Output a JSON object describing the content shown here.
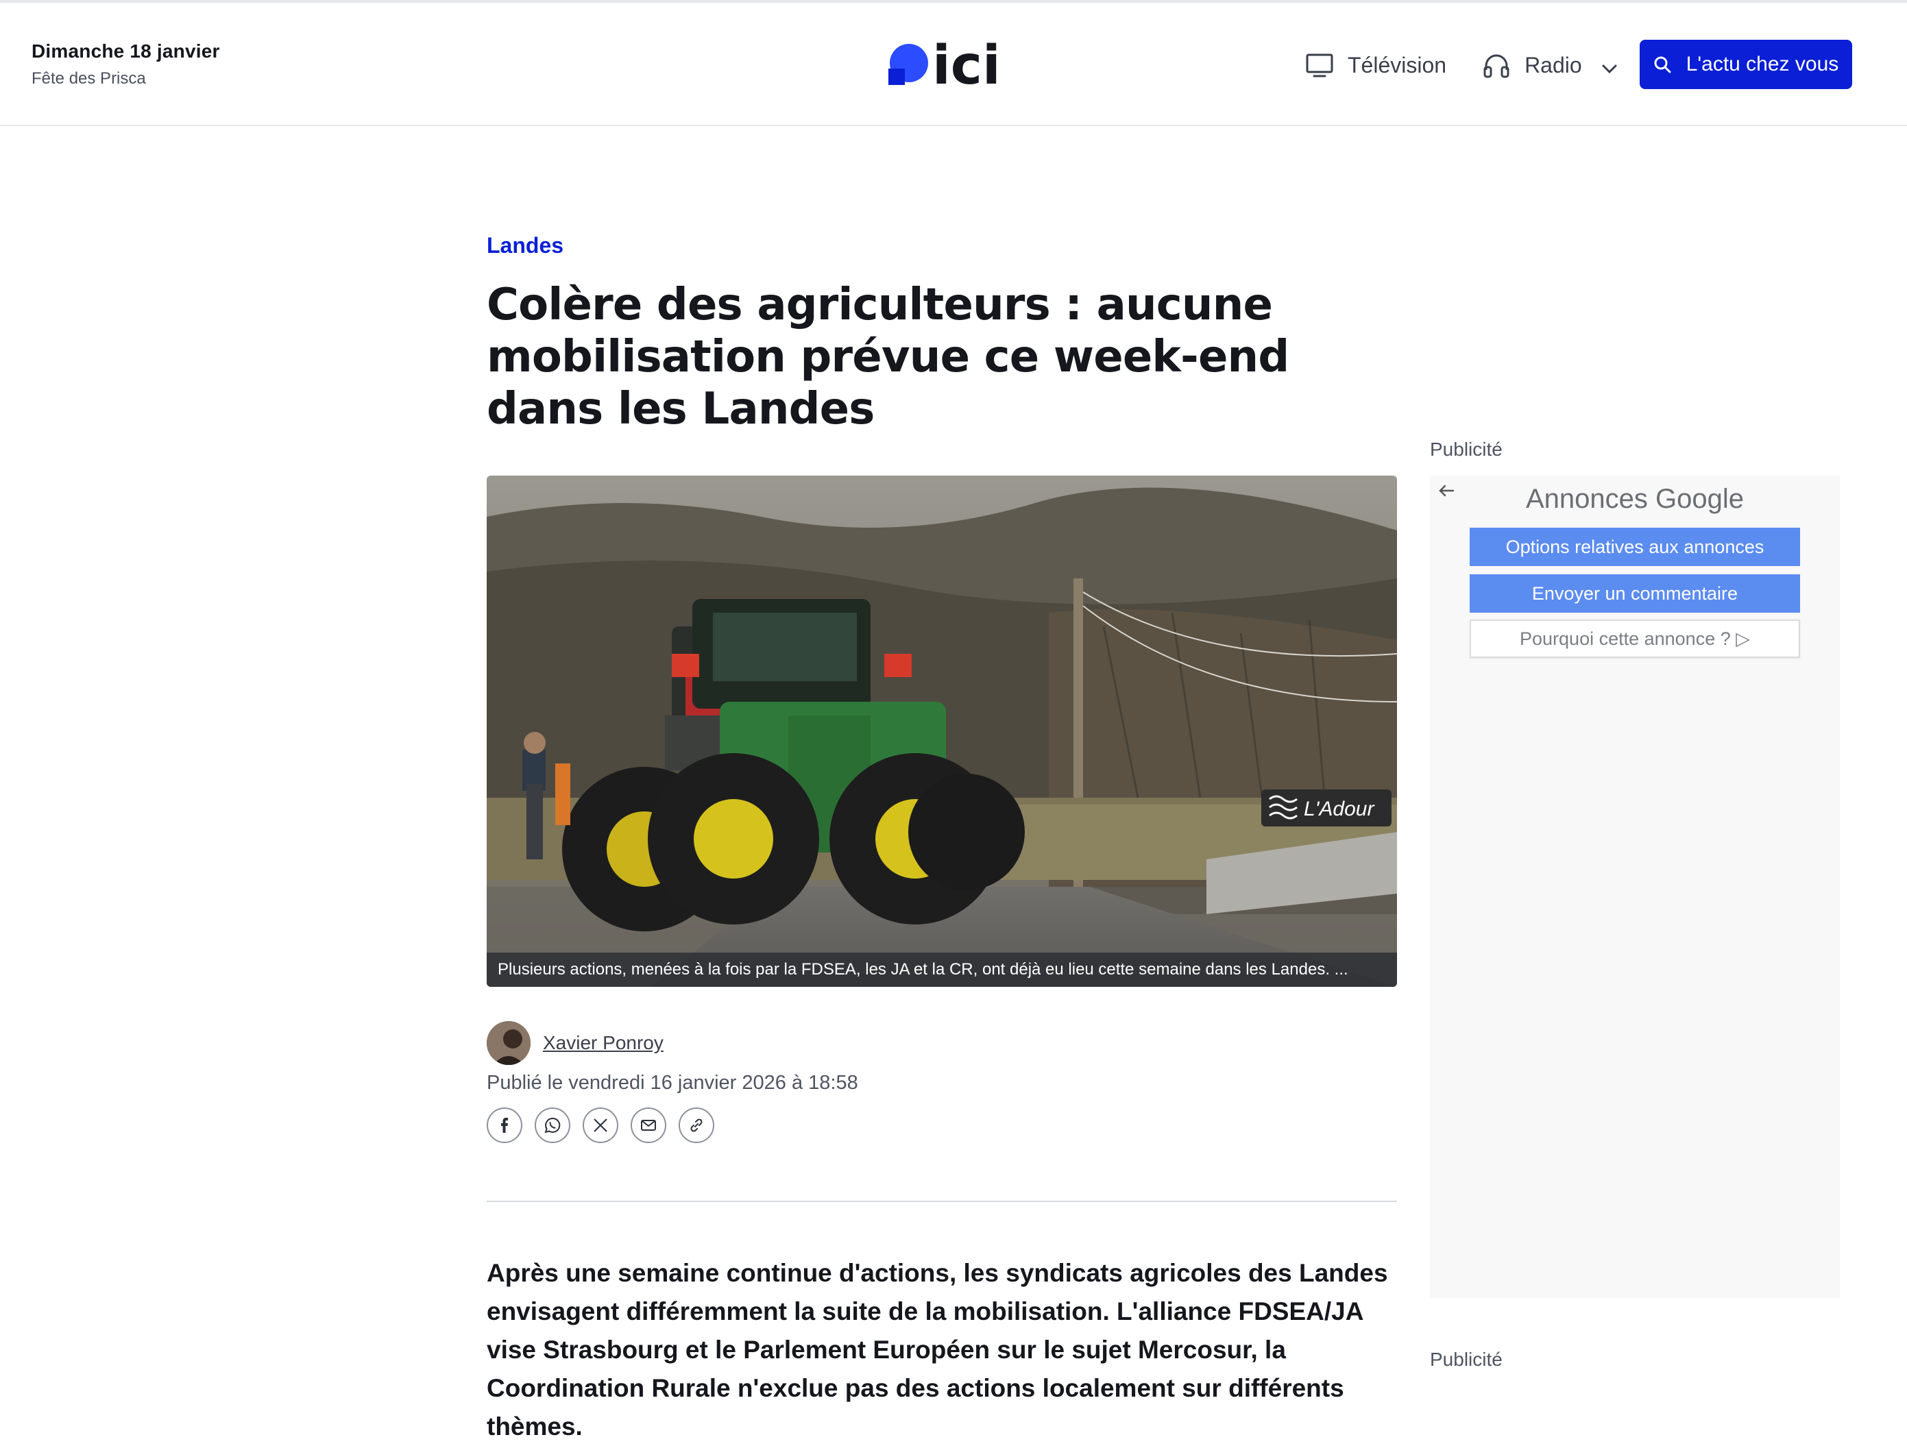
{
  "header": {
    "date": "Dimanche 18 janvier",
    "saint": "Fête des Prisca",
    "logo_text": "ici",
    "nav": {
      "television": "Télévision",
      "radio": "Radio"
    },
    "cta_label": "L'actu chez vous"
  },
  "article": {
    "category": "Landes",
    "title": "Colère des agriculteurs : aucune mobilisation prévue ce week-end dans les Landes",
    "photo_caption": "Plusieurs actions, menées à la fois par la FDSEA, les JA et la CR, ont déjà eu lieu cette semaine dans les Landes. ...",
    "photo_sign_text": "L'Adour",
    "author": "Xavier Ponroy",
    "published": "Publié le vendredi 16 janvier 2026 à 18:58",
    "share": [
      "facebook",
      "whatsapp",
      "x",
      "email",
      "link"
    ],
    "lead": "Après une semaine continue d'actions, les syndicats agricoles des Landes envisagent différemment la suite de la mobilisation. L'alliance FDSEA/JA vise Strasbourg et le Parlement Européen sur le sujet Mercosur, la Coordination Rurale n'exclue pas des actions localement sur différents thèmes."
  },
  "ads": {
    "label_top": "Publicité",
    "label_bottom": "Publicité",
    "title_prefix": "Annonces",
    "title_brand": "Google",
    "options_label": "Options relatives aux annonces",
    "feedback_label": "Envoyer un commentaire",
    "why_label": "Pourquoi cette annonce ? ▷"
  },
  "colors": {
    "brand_blue": "#0a1fd6",
    "ad_blue": "#5b8cf0"
  }
}
